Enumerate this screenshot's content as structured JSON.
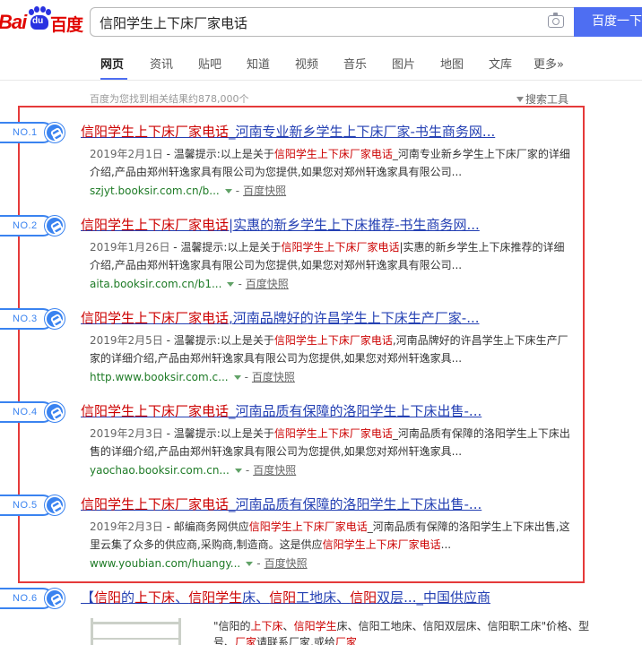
{
  "header": {
    "logo_bai": "Bai",
    "logo_du": "du",
    "logo_cn": "百度",
    "query": "信阳学生上下床厂家电话",
    "search_button": "百度一下"
  },
  "tabs": [
    {
      "label": "网页",
      "active": true
    },
    {
      "label": "资讯"
    },
    {
      "label": "贴吧"
    },
    {
      "label": "知道"
    },
    {
      "label": "视频"
    },
    {
      "label": "音乐"
    },
    {
      "label": "图片"
    },
    {
      "label": "地图"
    },
    {
      "label": "文库"
    },
    {
      "label": "更多»"
    }
  ],
  "result_count": "百度为您找到相关结果约878,000个",
  "search_tools": "搜索工具",
  "results": [
    {
      "rank": "NO.1",
      "title_hl": "信阳学生上下床厂家电话",
      "title_rest": "_河南专业新乡学生上下床厂家-书生商务网...",
      "date": "2019年2月1日",
      "snip_pre": " - 温馨提示:以上是关于",
      "snip_hl": "信阳学生上下床厂家电话",
      "snip_post": "_河南专业新乡学生上下床厂家的详细介绍,产品由郑州轩逸家具有限公司为您提供,如果您对郑州轩逸家具有限公司...",
      "url": "szjyt.booksir.com.cn/b...",
      "snapshot": "百度快照"
    },
    {
      "rank": "NO.2",
      "title_hl": "信阳学生上下床厂家电话",
      "title_rest": "|实惠的新乡学生上下床推荐-书生商务网...",
      "date": "2019年1月26日",
      "snip_pre": " - 温馨提示:以上是关于",
      "snip_hl": "信阳学生上下床厂家电话",
      "snip_post": "|实惠的新乡学生上下床推荐的详细介绍,产品由郑州轩逸家具有限公司为您提供,如果您对郑州轩逸家具有限公司...",
      "url": "aita.booksir.com.cn/b1...",
      "snapshot": "百度快照"
    },
    {
      "rank": "NO.3",
      "title_hl": "信阳学生上下床厂家电话",
      "title_rest": ",河南品牌好的许昌学生上下床生产厂家-...",
      "date": "2019年2月5日",
      "snip_pre": " - 温馨提示:以上是关于",
      "snip_hl": "信阳学生上下床厂家电话",
      "snip_post": ",河南品牌好的许昌学生上下床生产厂家的详细介绍,产品由郑州轩逸家具有限公司为您提供,如果您对郑州轩逸家具...",
      "url": "http.www.booksir.com.c...",
      "snapshot": "百度快照"
    },
    {
      "rank": "NO.4",
      "title_hl": "信阳学生上下床厂家电话",
      "title_rest": "_河南品质有保障的洛阳学生上下床出售-...",
      "date": "2019年2月3日",
      "snip_pre": " - 温馨提示:以上是关于",
      "snip_hl": "信阳学生上下床厂家电话",
      "snip_post": "_河南品质有保障的洛阳学生上下床出售的详细介绍,产品由郑州轩逸家具有限公司为您提供,如果您对郑州轩逸家具...",
      "url": "yaochao.booksir.com.cn...",
      "snapshot": "百度快照"
    },
    {
      "rank": "NO.5",
      "title_hl": "信阳学生上下床厂家电话",
      "title_rest": "_河南品质有保障的洛阳学生上下床出售-...",
      "date": "2019年2月3日",
      "snip_pre": " - 邮编商务网供应",
      "snip_hl": "信阳学生上下床厂家电话",
      "snip_post": "_河南品质有保障的洛阳学生上下床出售,这里云集了众多的供应商,采购商,制造商。这是供应",
      "snip_hl2": "信阳学生上下床厂家电话",
      "snip_tail": "...",
      "url": "www.youbian.com/huangy...",
      "snapshot": "百度快照"
    }
  ],
  "result6": {
    "rank": "NO.6",
    "title_a": "【",
    "title_hl1": "信阳",
    "title_b": "的",
    "title_hl2": "上下床",
    "title_c": "、",
    "title_hl3": "信阳学生",
    "title_d": "床、",
    "title_hl4": "信阳",
    "title_e": "工地床、",
    "title_hl5": "信阳",
    "title_f": "双层..._中国供应商",
    "snip_a": "\"信阳的",
    "snip_hl1": "上下床",
    "snip_b": "、",
    "snip_hl2": "信阳学生",
    "snip_c": "床、信阳工地床、信阳双层床、信阳职工床\"价格、型号、",
    "snip_hl3": "厂家",
    "snip_d": "请联系厂家,或给",
    "snip_hl4": "厂家"
  }
}
